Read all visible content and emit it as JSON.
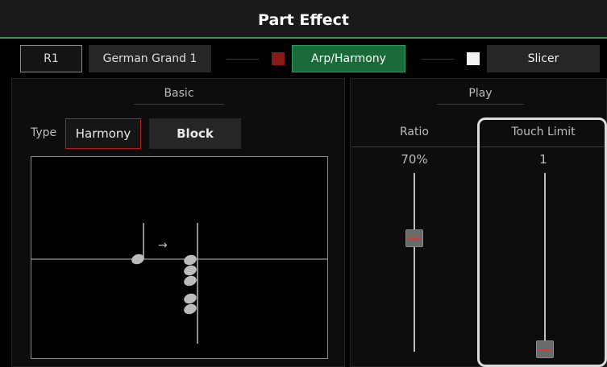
{
  "title": "Part Effect",
  "top_row": {
    "part": "R1",
    "voice": "German Grand 1",
    "arp_button": "Arp/Harmony",
    "slicer_button": "Slicer",
    "colors": {
      "arp_indicator": "#8a1a14",
      "arp_active": "#1a6a3a",
      "slicer_indicator": "#f2f2f2",
      "accent": "#2f9c5d"
    }
  },
  "basic": {
    "label": "Basic",
    "type_label": "Type",
    "type_value": "Harmony",
    "style_value": "Block",
    "display": {
      "arrow": "→",
      "icons": [
        "quarter-note-icon",
        "chord-stack-icon",
        "arrow-right-icon"
      ]
    }
  },
  "play": {
    "label": "Play",
    "ratio": {
      "label": "Ratio",
      "value": "70%",
      "level": 0.7
    },
    "touch_limit": {
      "label": "Touch Limit",
      "value": "1",
      "level": 0.0
    }
  }
}
